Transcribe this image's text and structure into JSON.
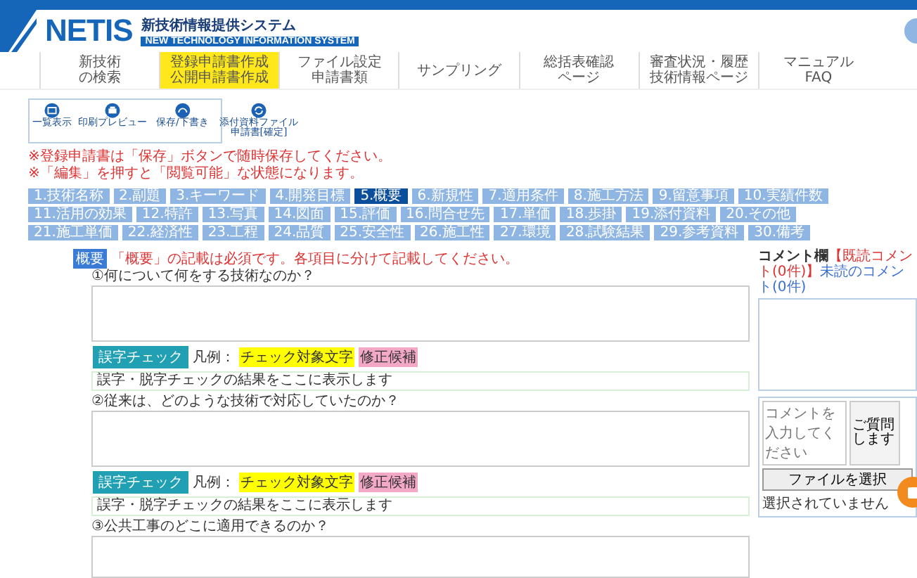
{
  "header": {
    "logo": "NETIS",
    "subtitle_ja": "新技術情報提供システム",
    "subtitle_en": "NEW TECHNOLOGY INFORMATION SYSTEM"
  },
  "nav": [
    {
      "lines": [
        "新技術",
        "の検索"
      ],
      "selected": false
    },
    {
      "lines": [
        "登録申請書作成",
        "公開申請書作成"
      ],
      "selected": true
    },
    {
      "lines": [
        "ファイル設定",
        "申請書類"
      ],
      "selected": false
    },
    {
      "lines": [
        "サンプリング"
      ],
      "selected": false
    },
    {
      "lines": [
        "総括表確認",
        "ページ"
      ],
      "selected": false
    },
    {
      "lines": [
        "審査状況・履歴",
        "技術情報ページ"
      ],
      "selected": false
    },
    {
      "lines": [
        "マニュアル",
        "FAQ"
      ],
      "selected": false
    }
  ],
  "toolbar": [
    {
      "kind": "list",
      "lines": [
        "一覧表示"
      ]
    },
    {
      "kind": "print",
      "lines": [
        "印刷プレビュー"
      ]
    },
    {
      "kind": "save",
      "lines": [
        "保存/下書き"
      ]
    },
    {
      "kind": "refresh",
      "lines": [
        "添付資料ファイル",
        "申請書[確定]"
      ]
    }
  ],
  "notices": [
    "※登録申請書は「保存」ボタンで随時保存してください。",
    "※「編集」を押すと「閲覧可能」な状態になります。"
  ],
  "sections": [
    {
      "label": "1.技術名称",
      "selected": false
    },
    {
      "label": "2.副題",
      "selected": false
    },
    {
      "label": "3.キーワード",
      "selected": false
    },
    {
      "label": "4.開発目標",
      "selected": false
    },
    {
      "label": "5.概要",
      "selected": true
    },
    {
      "label": "6.新規性",
      "selected": false
    },
    {
      "label": "7.適用条件",
      "selected": false
    },
    {
      "label": "8.施工方法",
      "selected": false
    },
    {
      "label": "9.留意事項",
      "selected": false
    },
    {
      "label": "10.実績件数",
      "selected": false
    },
    {
      "label": "11.活用の効果",
      "selected": false
    },
    {
      "label": "12.特許",
      "selected": false
    },
    {
      "label": "13.写真",
      "selected": false
    },
    {
      "label": "14.図面",
      "selected": false
    },
    {
      "label": "15.評価",
      "selected": false
    },
    {
      "label": "16.問合せ先",
      "selected": false
    },
    {
      "label": "17.単価",
      "selected": false
    },
    {
      "label": "18.歩掛",
      "selected": false
    },
    {
      "label": "19.添付資料",
      "selected": false
    },
    {
      "label": "20.その他",
      "selected": false
    },
    {
      "label": "21.施工単価",
      "selected": false
    },
    {
      "label": "22.経済性",
      "selected": false
    },
    {
      "label": "23.工程",
      "selected": false
    },
    {
      "label": "24.品質",
      "selected": false
    },
    {
      "label": "25.安全性",
      "selected": false
    },
    {
      "label": "26.施工性",
      "selected": false
    },
    {
      "label": "27.環境",
      "selected": false
    },
    {
      "label": "28.試験結果",
      "selected": false
    },
    {
      "label": "29.参考資料",
      "selected": false
    },
    {
      "label": "30.備考",
      "selected": false
    }
  ],
  "editor": {
    "heading": "概要",
    "note": "「概要」の記載は必須です。各項目に分けて記載してください。",
    "questions": [
      {
        "text": "①何について何をする技術なのか？",
        "check": {
          "button": "誤字チェック",
          "legend": "凡例：",
          "target": "チェック対象文字",
          "fix": "修正候補",
          "result": "誤字・脱字チェックの結果をここに表示します"
        }
      },
      {
        "text": "②従来は、どのような技術で対応していたのか？",
        "check": {
          "button": "誤字チェック",
          "legend": "凡例：",
          "target": "チェック対象文字",
          "fix": "修正候補",
          "result": "誤字・脱字チェックの結果をここに表示します"
        }
      },
      {
        "text": "③公共工事のどこに適用できるのか？"
      }
    ]
  },
  "comments": {
    "heading": "コメント欄",
    "read": "【既読コメント(0件)】",
    "unread": "未読のコメント(0件)",
    "placeholder": "コメントを入力してください",
    "reply_lines": [
      "ご質問",
      "します"
    ],
    "file_button": "ファイルを選択",
    "file_status": "選択されていません"
  }
}
